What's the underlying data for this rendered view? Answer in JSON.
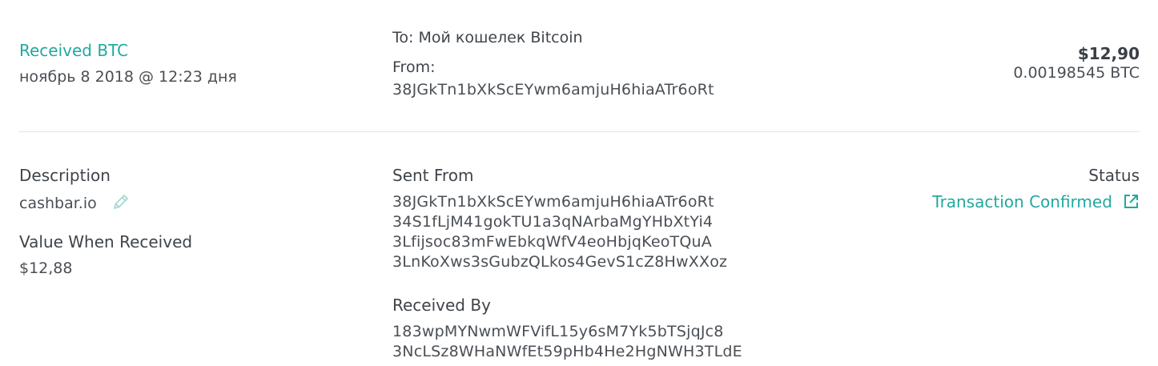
{
  "summary": {
    "type_label": "Received BTC",
    "date": "ноябрь 8 2018 @ 12:23 дня",
    "to_label": "To:",
    "to_wallet_name": "Мой кошелек",
    "to_wallet_currency": "Bitcoin",
    "from_label": "From:",
    "from_address": "38JGkTn1bXkScEYwm6amjuH6hiaATr6oRt",
    "fiat_amount": "$12,90",
    "crypto_amount": "0.00198545 BTC"
  },
  "details": {
    "description_heading": "Description",
    "description_value": "cashbar.io",
    "value_heading": "Value When Received",
    "value_amount": "$12,88",
    "sent_from_heading": "Sent From",
    "sent_from_addresses": [
      "38JGkTn1bXkScEYwm6amjuH6hiaATr6oRt",
      "34S1fLjM41gokTU1a3qNArbaMgYHbXtYi4",
      "3Lfijsoc83mFwEbkqWfV4eoHbjqKeoTQuA",
      "3LnKoXws3sGubzQLkos4GevS1cZ8HwXXoz"
    ],
    "received_by_heading": "Received By",
    "received_by_addresses": [
      "183wpMYNwmWFVifL15y6sM7Yk5bTSjqJc8",
      "3NcLSz8WHaNWfEt59pHb4He2HgNWH3TLdE"
    ],
    "status_heading": "Status",
    "status_value": "Transaction Confirmed"
  },
  "icons": {
    "edit": "pencil-icon",
    "external": "external-link-icon"
  },
  "colors": {
    "accent": "#21a99f",
    "text": "#3f444a",
    "divider": "#e3e5e8"
  }
}
